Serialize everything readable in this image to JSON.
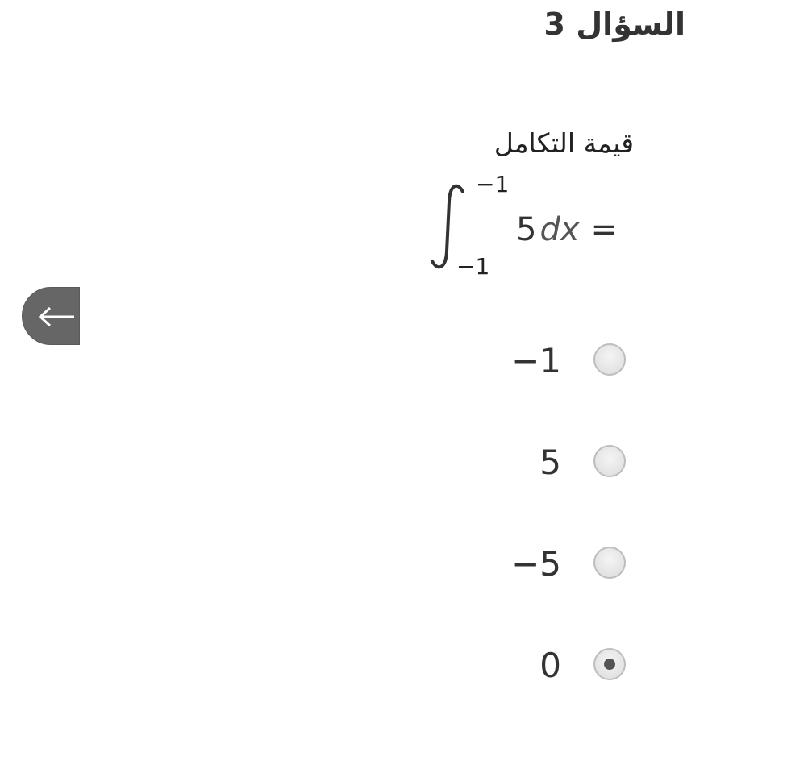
{
  "question": {
    "title": "السؤال 3",
    "prompt": "قيمة التكامل",
    "integral": {
      "upper_limit": "−1",
      "lower_limit": "−1",
      "coefficient": "5",
      "variable": "dx",
      "equals": "="
    }
  },
  "navigation": {
    "back_icon": "arrow-left-icon"
  },
  "options": [
    {
      "label": "−1",
      "selected": false
    },
    {
      "label": "5",
      "selected": false
    },
    {
      "label": "−5",
      "selected": false
    },
    {
      "label": "0",
      "selected": true
    }
  ],
  "colors": {
    "back_button": "#666666",
    "radio_border": "#bdbdbd",
    "radio_dot": "#555555"
  }
}
